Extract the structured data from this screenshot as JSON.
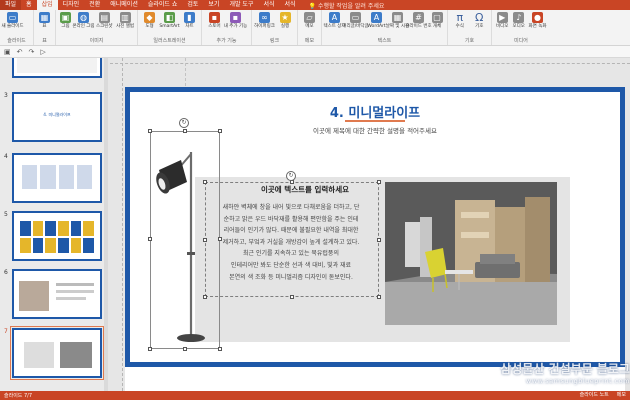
{
  "tabs": [
    "파일",
    "홈",
    "삽입",
    "디자인",
    "전환",
    "애니메이션",
    "슬라이드 쇼",
    "검토",
    "보기",
    "개발 도구",
    "서식",
    "서식",
    "수행할 작업을 알려 주세요"
  ],
  "ribbon": {
    "groups": [
      {
        "label": "슬라이드",
        "buttons": [
          {
            "label": "새 슬라이드",
            "icon": "new-slide-icon"
          }
        ]
      },
      {
        "label": "표",
        "buttons": [
          {
            "label": "표",
            "icon": "table-icon"
          }
        ]
      },
      {
        "label": "이미지",
        "buttons": [
          {
            "label": "그림",
            "icon": "picture-icon"
          },
          {
            "label": "온라인 그림",
            "icon": "online-picture-icon"
          },
          {
            "label": "스크린샷",
            "icon": "screenshot-icon"
          },
          {
            "label": "사진 앨범",
            "icon": "album-icon"
          }
        ]
      },
      {
        "label": "일러스트레이션",
        "buttons": [
          {
            "label": "도형",
            "icon": "shapes-icon"
          },
          {
            "label": "SmartArt",
            "icon": "smartart-icon"
          },
          {
            "label": "차트",
            "icon": "chart-icon"
          }
        ]
      },
      {
        "label": "추가 기능",
        "buttons": [
          {
            "label": "스토어",
            "icon": "store-icon"
          },
          {
            "label": "내 추가 기능",
            "icon": "addin-icon"
          }
        ]
      },
      {
        "label": "링크",
        "buttons": [
          {
            "label": "하이퍼링크",
            "icon": "link-icon"
          },
          {
            "label": "실행",
            "icon": "action-icon"
          }
        ]
      },
      {
        "label": "메모",
        "buttons": [
          {
            "label": "메모",
            "icon": "comment-icon"
          }
        ]
      },
      {
        "label": "텍스트",
        "buttons": [
          {
            "label": "텍스트 상자",
            "icon": "textbox-icon"
          },
          {
            "label": "머리글/바닥글",
            "icon": "header-icon"
          },
          {
            "label": "WordArt",
            "icon": "wordart-icon"
          },
          {
            "label": "날짜 및 시간",
            "icon": "date-icon"
          },
          {
            "label": "슬라이드 번호",
            "icon": "slide-number-icon"
          },
          {
            "label": "개체",
            "icon": "object-icon"
          }
        ]
      },
      {
        "label": "기호",
        "buttons": [
          {
            "label": "수식",
            "icon": "equation-icon"
          },
          {
            "label": "기호",
            "icon": "symbol-icon"
          }
        ]
      },
      {
        "label": "미디어",
        "buttons": [
          {
            "label": "비디오",
            "icon": "video-icon"
          },
          {
            "label": "오디오",
            "icon": "audio-icon"
          },
          {
            "label": "화면 녹화",
            "icon": "record-icon"
          }
        ]
      }
    ]
  },
  "thumbnails": [
    {
      "num": "3",
      "title": "4. 미니멀라이프"
    },
    {
      "num": "4",
      "title": ""
    },
    {
      "num": "5",
      "title": ""
    },
    {
      "num": "6",
      "title": ""
    },
    {
      "num": "7",
      "title": ""
    }
  ],
  "slide": {
    "title": "4. 미니멀라이프",
    "subtitle": "이곳에 제목에 대한 간략한 설명을 적어주세요",
    "text_title": "이곳에 텍스트를 입력하세요",
    "text_body": [
      "새하얀 벽체에 창을 내어 빛으로 다채로움을 더하고, 단",
      "순하고 밝은 우드 바닥재를 활용해 편안함을 주는 인테",
      "리어들이 인기가 많다. 때문에 불필요한 내역을 최대한",
      "제거하고, 부엌과 거실을 개방감이 높게 설계하고 있다.",
      "최근 인기를 지속하고 있는 북유럽풍의",
      "인테리어만 봐도 단순한 선과 색 대비, 빛과 재료",
      "본연의 색 조화 등 미니멀리즘 디자인이 돋보인다."
    ]
  },
  "watermark": {
    "line1": "삼성물산 건설부문 블로그",
    "line2": "www.samsungblueprint.com"
  },
  "status": {
    "slide_info": "슬라이드 7/7",
    "notes": "슬라이드 노트",
    "comments": "메모"
  },
  "colors": {
    "accent": "#c94525",
    "slide_blue": "#1e58a8",
    "highlight": "#e07a4f"
  }
}
